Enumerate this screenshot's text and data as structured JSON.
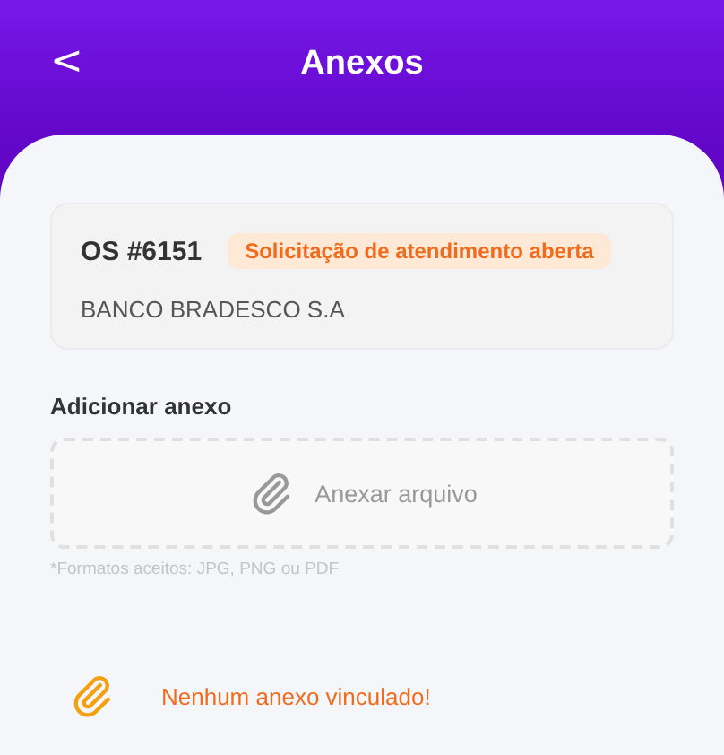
{
  "header": {
    "back": "<",
    "title": "Anexos"
  },
  "order": {
    "number": "OS #6151",
    "status": "Solicitação de atendimento aberta",
    "client": "BANCO BRADESCO S.A"
  },
  "attach": {
    "label": "Adicionar anexo",
    "button": "Anexar arquivo",
    "note": "*Formatos aceitos: JPG, PNG ou PDF"
  },
  "empty": {
    "message": "Nenhum anexo vinculado!"
  }
}
